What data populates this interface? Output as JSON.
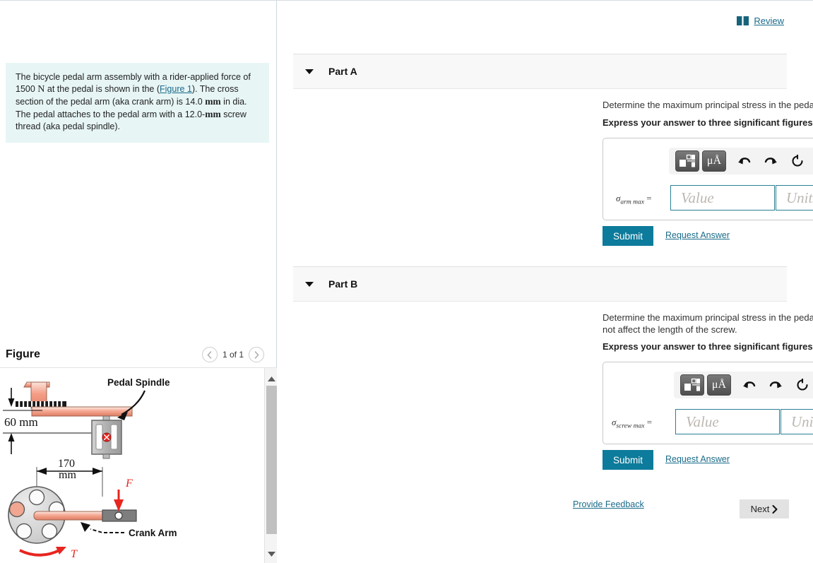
{
  "problem": {
    "text_part1": "The bicycle pedal arm assembly with a rider-applied force of 1500 ",
    "force_unit": "N",
    "text_part2": " at the pedal is shown in the (",
    "figure_link": "Figure 1",
    "text_part3": "). The cross section of the pedal arm (aka crank arm) is 14.0 ",
    "dia_unit": "mm",
    "text_part4": " in dia. The pedal attaches to the pedal arm with a 12.0-",
    "screw_unit": "mm",
    "text_part5": " screw thread (aka pedal spindle)."
  },
  "figure": {
    "title": "Figure",
    "pager_label": "1 of 1",
    "prev_icon": "chevron-left-icon",
    "next_icon": "chevron-right-icon",
    "labels": {
      "pedal_spindle": "Pedal Spindle",
      "crank_arm": "Crank Arm",
      "dim_60": "60 mm",
      "dim_170_line1": "170",
      "dim_170_line2": "mm",
      "force": "F",
      "torque": "T"
    },
    "colors": {
      "arm_red": "#f5a08c",
      "arm_outline": "#8a5a4a",
      "gray_body": "#b5b5b5",
      "gray_outline": "#6e6e6e",
      "red_accent": "#e8251f"
    }
  },
  "header": {
    "review_label": "Review",
    "review_icon": "book-icon"
  },
  "parts": [
    {
      "title": "Part A",
      "caret_icon": "caret-down-icon",
      "question": "Determine the maximum principal stress in the pedal arm (i.e Crank Arm).",
      "instruction": "Express your answer to three significant figures and include the appropriate units.",
      "answer_symbol": "σ",
      "answer_subscript": "arm max",
      "answer_equals": "=",
      "value_placeholder": "Value",
      "units_placeholder": "Units",
      "value_current": "",
      "units_current": "",
      "submit_label": "Submit",
      "request_answer_label": "Request Answer"
    },
    {
      "title": "Part B",
      "caret_icon": "caret-down-icon",
      "question": "Determine the maximum principal stress in the pedal screw (pedal spindle). Assume that the arm's diameter does not affect the length of the screw.",
      "instruction": "Express your answer to three significant figures and include the appropriate units.",
      "answer_symbol": "σ",
      "answer_subscript": "screw max",
      "answer_equals": "=",
      "value_placeholder": "Value",
      "units_placeholder": "Units",
      "value_current": "",
      "units_current": "",
      "submit_label": "Submit",
      "request_answer_label": "Request Answer"
    }
  ],
  "toolbar": {
    "template_icon": "math-template-icon",
    "units_label": "μÅ",
    "undo_icon": "undo-arrow-icon",
    "redo_icon": "redo-arrow-icon",
    "reset_icon": "reset-circle-icon",
    "keyboard_icon": "keyboard-icon",
    "help_label": "?"
  },
  "footer": {
    "feedback_label": "Provide Feedback",
    "next_label": "Next",
    "next_icon": "chevron-right-icon"
  },
  "scrollbar": {
    "up_icon": "triangle-up-icon",
    "down_icon": "triangle-down-icon"
  },
  "colors": {
    "accent_teal": "#0d7b9b",
    "link_blue": "#1a6b8a",
    "info_bg": "#e7f5f5",
    "part_header_bg": "#f8f8f8"
  }
}
